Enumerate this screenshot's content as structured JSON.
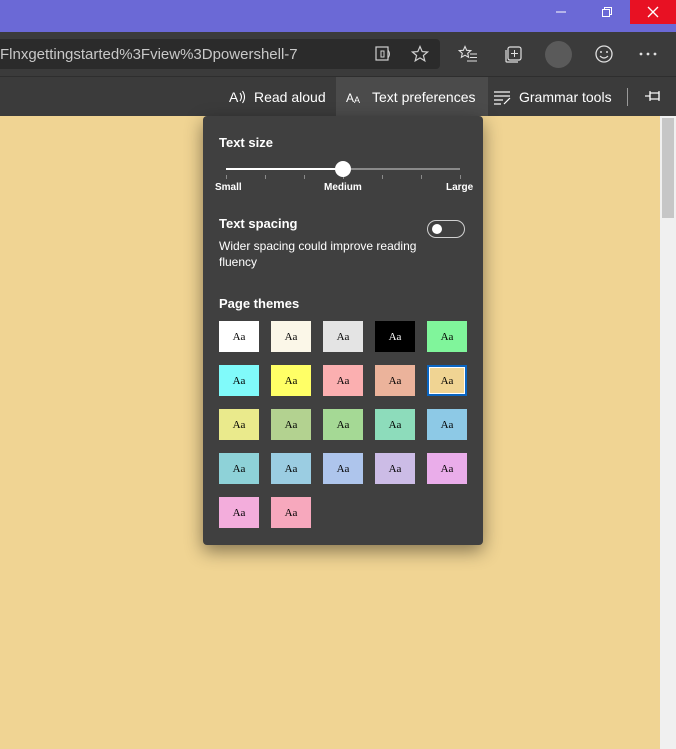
{
  "address_bar": {
    "url": "Flnxgettingstarted%3Fview%3Dpowershell-7"
  },
  "reader_toolbar": {
    "read_aloud": "Read aloud",
    "text_preferences": "Text preferences",
    "grammar_tools": "Grammar tools"
  },
  "text_prefs": {
    "text_size": {
      "title": "Text size",
      "min_label": "Small",
      "mid_label": "Medium",
      "max_label": "Large",
      "value_fraction": 0.5
    },
    "text_spacing": {
      "title": "Text spacing",
      "description": "Wider spacing could improve reading fluency",
      "enabled": false
    },
    "page_themes": {
      "title": "Page themes",
      "swatch_label": "Aa",
      "selected_index": 9,
      "colors": [
        "#ffffff",
        "#fbf7e8",
        "#e4e4e4",
        "#000000",
        "#80f59b",
        "#80fafa",
        "#ffff66",
        "#fbafb0",
        "#ebb39b",
        "#f0d493",
        "#eaea8c",
        "#b3d290",
        "#a5d995",
        "#8ddcbb",
        "#8dc9e6",
        "#8ed2d8",
        "#9bcde2",
        "#aec5ec",
        "#ccbce6",
        "#eaadea",
        "#f3addc",
        "#f7a8bd"
      ]
    }
  },
  "colors": {
    "titlebar": "#6b69d6",
    "page_bg": "#f0d493",
    "panel_bg": "#404040",
    "close": "#e81123"
  }
}
